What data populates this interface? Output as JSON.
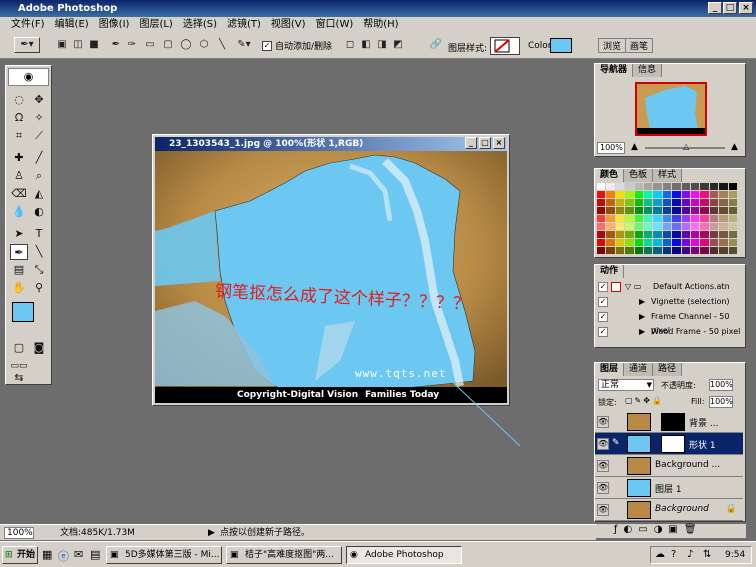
{
  "app": {
    "title": "Adobe Photoshop"
  },
  "menu": [
    "文件(F)",
    "编辑(E)",
    "图像(I)",
    "图层(L)",
    "选择(S)",
    "滤镜(T)",
    "视图(V)",
    "窗口(W)",
    "帮助(H)"
  ],
  "options": {
    "auto_add_delete": "自动添加/删除",
    "layer_style_label": "图层样式:",
    "color_label": "Color:",
    "color_value": "#6cc8f0",
    "tab_browse": "浏览",
    "tab_brushes": "画笔"
  },
  "document": {
    "title": "23_1303543_1.jpg @ 100%(形状 1,RGB)",
    "annotation": "钢笔抠怎么成了这个样子？？？？",
    "watermark": "www.tqts.net",
    "caption_left": "Copyright-Digital Vision",
    "caption_right": "Families Today"
  },
  "navigator": {
    "tabs": [
      "导航器",
      "信息"
    ],
    "zoom": "100%"
  },
  "color_panel": {
    "tabs": [
      "颜色",
      "色板",
      "样式"
    ]
  },
  "actions": {
    "tab": "动作",
    "items": [
      "Default Actions.atn",
      "Vignette (selection)",
      "Frame Channel - 50 pixel",
      "Wood Frame - 50 pixel"
    ]
  },
  "layers": {
    "tabs": [
      "图层",
      "通道",
      "路径"
    ],
    "blend_mode": "正常",
    "opacity_label": "不透明度:",
    "opacity": "100%",
    "lock_label": "锁定:",
    "fill_label": "Fill:",
    "fill": "100%",
    "items": [
      "背景 ...",
      "形状 1",
      "Background ...",
      "图层 1",
      "Background"
    ]
  },
  "status": {
    "zoom": "100%",
    "doc_info": "文档:485K/1.73M",
    "hint": "点按以创建新子路径。"
  },
  "taskbar": {
    "start": "开始",
    "tasks": [
      "5D多媒体第三版 - Mi...",
      "桔子\"高难度抠图\"两...",
      "Adobe Photoshop"
    ],
    "clock": "9:54"
  }
}
